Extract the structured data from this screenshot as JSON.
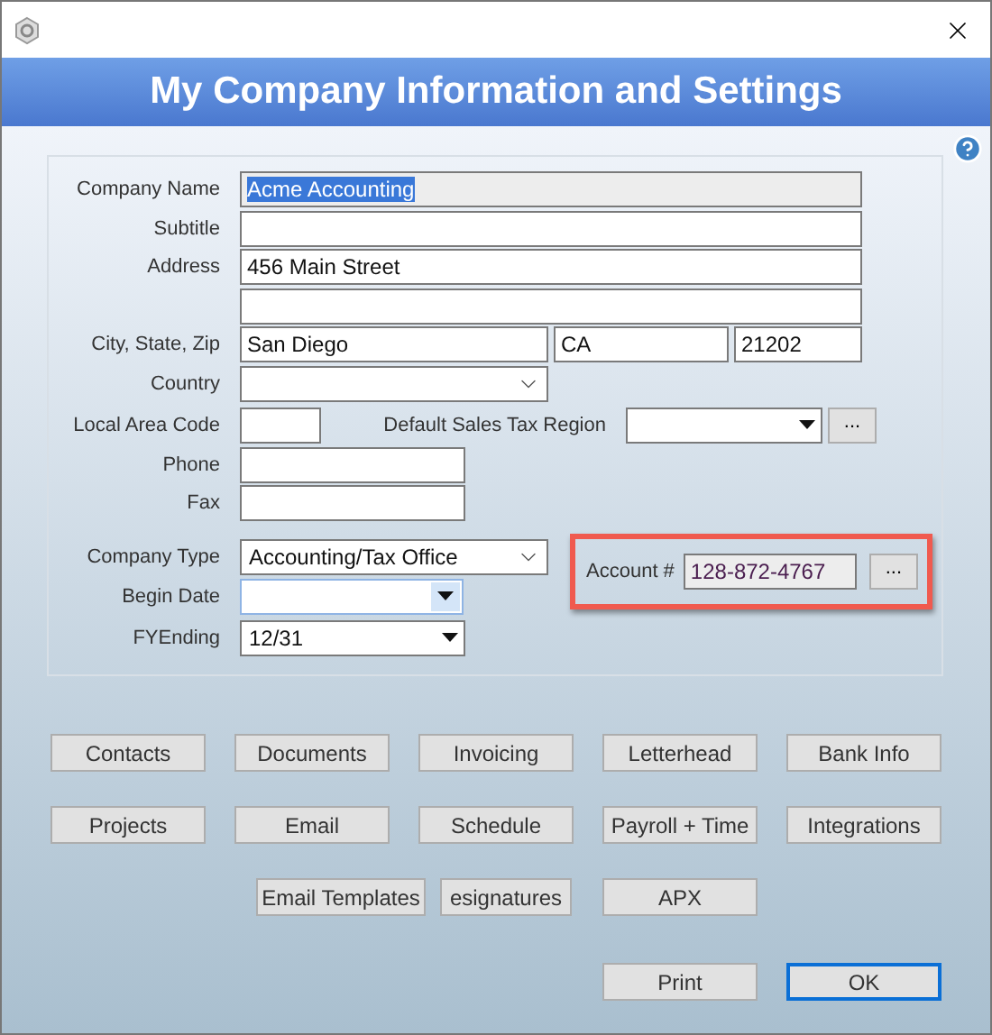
{
  "window": {
    "title": "My Company Information and Settings"
  },
  "form": {
    "company_name": {
      "label": "Company Name",
      "value": "Acme Accounting",
      "selected": true
    },
    "subtitle": {
      "label": "Subtitle"
    },
    "address": {
      "label": "Address",
      "value": "456 Main Street"
    },
    "city_state_zip": {
      "label": "City, State, Zip",
      "city": "San Diego",
      "state": "CA",
      "zip": "21202"
    },
    "country": {
      "label": "Country"
    },
    "local_area_code": {
      "label": "Local Area Code"
    },
    "sales_tax_region": {
      "label": "Default Sales Tax Region",
      "button": "..."
    },
    "phone": {
      "label": "Phone"
    },
    "fax": {
      "label": "Fax"
    },
    "company_type": {
      "label": "Company Type",
      "value": "Accounting/Tax Office"
    },
    "begin_date": {
      "label": "Begin Date",
      "focused": true
    },
    "fy_ending": {
      "label": "FYEnding",
      "value": "12/31"
    },
    "account": {
      "label": "Account #",
      "value": "128-872-4767",
      "button": "..."
    }
  },
  "button_rows": [
    [
      {
        "label": "Contacts"
      },
      {
        "label": "Documents"
      },
      {
        "label": "Invoicing"
      },
      {
        "label": "Letterhead"
      },
      {
        "label": "Bank Info"
      }
    ],
    [
      {
        "label": "Projects"
      },
      {
        "label": "Email"
      },
      {
        "label": "Schedule"
      },
      {
        "label": "Payroll + Time"
      },
      {
        "label": "Integrations"
      }
    ],
    [
      {
        "label": "Email Templates"
      },
      {
        "label": "esignatures"
      },
      {
        "label": "APX"
      }
    ]
  ],
  "actions": [
    {
      "label": "Print",
      "default": false
    },
    {
      "label": "OK",
      "default": true
    }
  ]
}
